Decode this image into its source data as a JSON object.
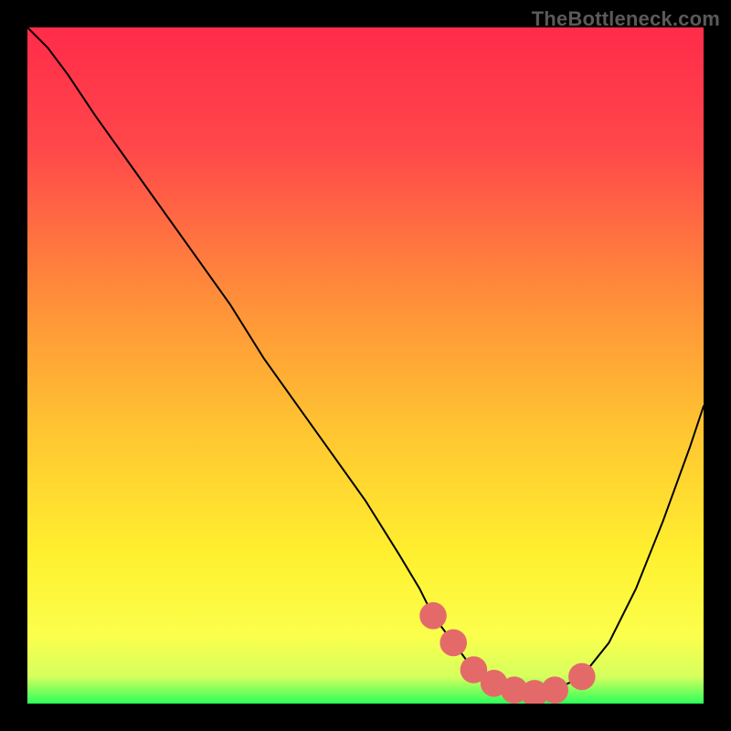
{
  "watermark": "TheBottleneck.com",
  "colors": {
    "curve": "#000000",
    "marker": "#e46a6a",
    "gradient_stops": [
      {
        "offset": "0%",
        "color": "#ff2b4a"
      },
      {
        "offset": "18%",
        "color": "#ff484a"
      },
      {
        "offset": "40%",
        "color": "#ff8e3a"
      },
      {
        "offset": "60%",
        "color": "#ffc631"
      },
      {
        "offset": "78%",
        "color": "#fff02f"
      },
      {
        "offset": "90%",
        "color": "#fbff4c"
      },
      {
        "offset": "96%",
        "color": "#d6ff5e"
      },
      {
        "offset": "100%",
        "color": "#2dff5a"
      }
    ]
  },
  "chart_data": {
    "type": "line",
    "title": "",
    "xlabel": "",
    "ylabel": "",
    "xlim": [
      0,
      100
    ],
    "ylim": [
      0,
      100
    ],
    "grid": false,
    "x": [
      0,
      3,
      6,
      10,
      15,
      20,
      25,
      30,
      35,
      40,
      45,
      50,
      55,
      58,
      60,
      63,
      66,
      69,
      72,
      75,
      78,
      82,
      86,
      90,
      94,
      98,
      100
    ],
    "values": [
      100,
      97,
      93,
      87,
      80,
      73,
      66,
      59,
      51,
      44,
      37,
      30,
      22,
      17,
      13,
      9,
      5,
      3,
      2,
      1.5,
      2,
      4,
      9,
      17,
      27,
      38,
      44
    ],
    "markers_x": [
      60,
      63,
      66,
      69,
      72,
      75,
      78,
      82
    ],
    "markers_y": [
      13,
      9,
      5,
      3,
      2,
      1.5,
      2,
      4
    ],
    "marker_radius": 2.0,
    "annotations": []
  }
}
